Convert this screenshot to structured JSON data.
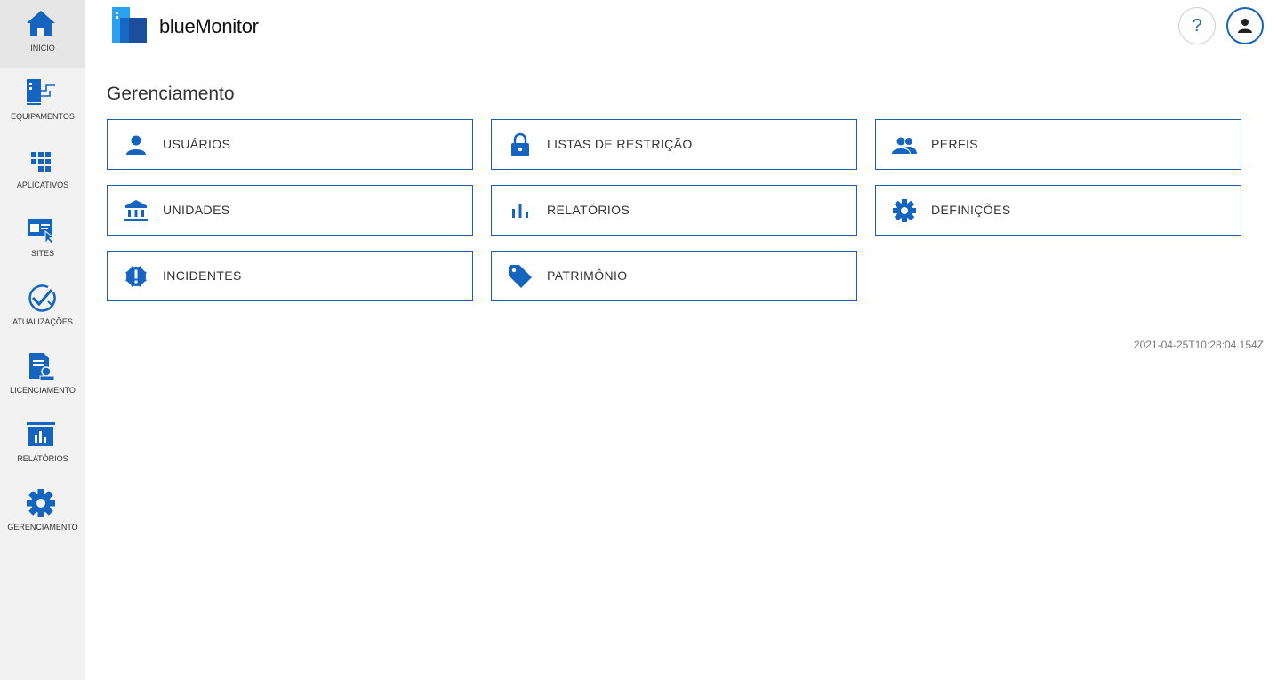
{
  "sidebar": {
    "items": [
      {
        "label": "INÍCIO",
        "icon": "home-icon"
      },
      {
        "label": "EQUIPAMENTOS",
        "icon": "devices-icon"
      },
      {
        "label": "APLICATIVOS",
        "icon": "apps-grid-icon"
      },
      {
        "label": "SITES",
        "icon": "browser-cursor-icon"
      },
      {
        "label": "ATUALIZAÇÕES",
        "icon": "check-circle-icon"
      },
      {
        "label": "LICENCIAMENTO",
        "icon": "license-icon"
      },
      {
        "label": "RELATÓRIOS",
        "icon": "bar-chart-icon"
      },
      {
        "label": "GERENCIAMENTO",
        "icon": "gear-icon"
      }
    ]
  },
  "header": {
    "app_name": "blueMonitor",
    "help_label": "?"
  },
  "main": {
    "title": "Gerenciamento",
    "cards": [
      {
        "label": "USUÁRIOS",
        "icon": "person-icon"
      },
      {
        "label": "LISTAS DE RESTRIÇÃO",
        "icon": "lock-icon"
      },
      {
        "label": "PERFIS",
        "icon": "people-icon"
      },
      {
        "label": "UNIDADES",
        "icon": "bank-icon"
      },
      {
        "label": "RELATÓRIOS",
        "icon": "bar-chart-icon"
      },
      {
        "label": "DEFINIÇÕES",
        "icon": "gear-icon"
      },
      {
        "label": "INCIDENTES",
        "icon": "alert-badge-icon"
      },
      {
        "label": "PATRIMÔNIO",
        "icon": "tag-icon"
      }
    ],
    "timestamp": "2021-04-25T10:28:04.154Z"
  },
  "colors": {
    "accent": "#1565c0",
    "card_border": "#1a5fa8",
    "sidebar_bg": "#f2f2f2"
  }
}
